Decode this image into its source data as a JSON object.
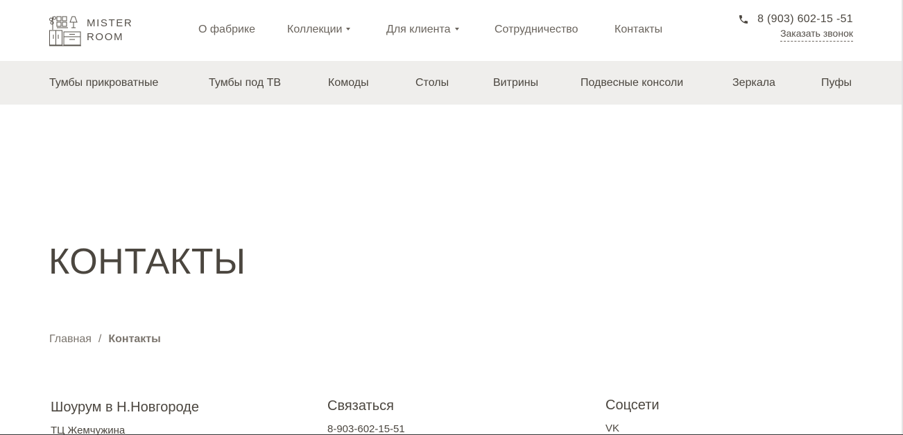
{
  "brand": {
    "line1": "MISTER",
    "line2": "ROOM"
  },
  "nav": {
    "items": [
      {
        "label": "О фабрике",
        "dropdown": false
      },
      {
        "label": "Коллекции",
        "dropdown": true
      },
      {
        "label": "Для клиента",
        "dropdown": true
      },
      {
        "label": "Сотрудничество",
        "dropdown": false
      },
      {
        "label": "Контакты",
        "dropdown": false
      }
    ]
  },
  "header_contact": {
    "phone": "8 (903) 602-15 -51",
    "callback_label": "Заказать звонок",
    "icon": "phone-icon"
  },
  "categories": {
    "items": [
      "Тумбы прикроватные",
      "Тумбы под ТВ",
      "Комоды",
      "Столы",
      "Витрины",
      "Подвесные консоли",
      "Зеркала",
      "Пуфы"
    ]
  },
  "page": {
    "title": "КОНТАКТЫ"
  },
  "breadcrumb": {
    "home": "Главная",
    "separator": "/",
    "current": "Контакты"
  },
  "columns": {
    "showroom": {
      "title": "Шоурум в Н.Новгороде",
      "sub": "ТЦ Жемчужина"
    },
    "contact": {
      "title": "Связаться",
      "sub": "8-903-602-15-51"
    },
    "social": {
      "title": "Соцсети",
      "sub": "VK"
    }
  },
  "colors": {
    "text": "#4b463f",
    "muted": "#7b756e",
    "category_bar": "#efeeec"
  }
}
